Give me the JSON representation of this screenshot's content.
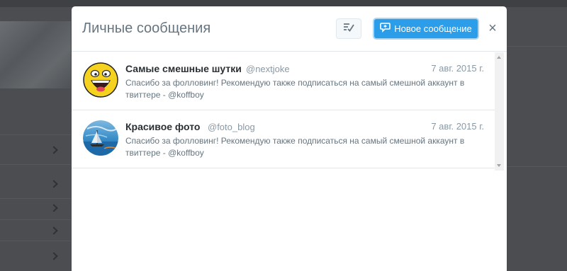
{
  "modal": {
    "title": "Личные сообщения",
    "new_message_label": "Новое сообщение",
    "close_symbol": "×"
  },
  "messages": [
    {
      "name": "Самые смешные шутки",
      "handle": "@nextjoke",
      "date": "7 авг. 2015 г.",
      "text": "Спасибо за фолловинг! Рекомендую также подписаться на самый смешной аккаунт в твиттере - @koffboy"
    },
    {
      "name": "Красивое фото",
      "handle": "@foto_blog",
      "date": "7 авг. 2015 г.",
      "text": "Спасибо за фолловинг! Рекомендую также подписаться на самый смешной аккаунт в твиттере - @koffboy"
    }
  ],
  "icons": {
    "mark_read": "mark-all-read-icon",
    "compose": "compose-message-icon",
    "close": "close-icon"
  },
  "colors": {
    "accent": "#2b9de9",
    "overlay": "#4b4d50"
  }
}
